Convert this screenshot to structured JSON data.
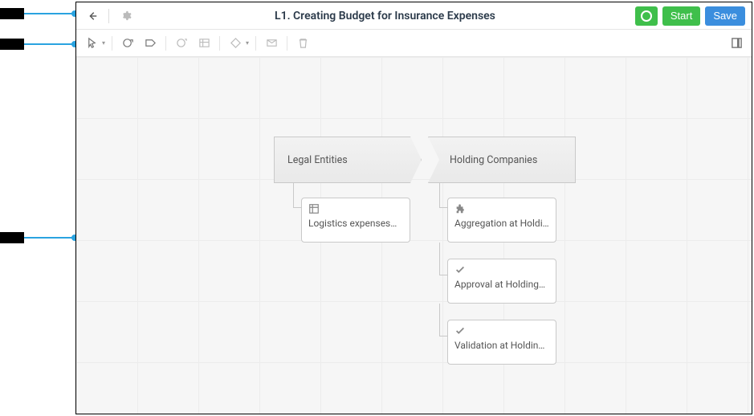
{
  "header": {
    "title": "L1. Creating Budget for Insurance Expenses",
    "start_label": "Start",
    "save_label": "Save"
  },
  "toolbar": {
    "tools": [
      "pointer",
      "create-stage",
      "create-task",
      "group",
      "table",
      "diamond",
      "layout",
      "delete"
    ]
  },
  "canvas": {
    "stages": [
      {
        "name": "Legal Entities"
      },
      {
        "name": "Holding Companies"
      }
    ],
    "nodes": [
      {
        "id": "n1",
        "label": "Logistics expenses…",
        "icon": "table"
      },
      {
        "id": "n2",
        "label": "Aggregation at Holding…",
        "icon": "puzzle"
      },
      {
        "id": "n3",
        "label": "Approval at Holding…",
        "icon": "check"
      },
      {
        "id": "n4",
        "label": "Validation at Holding…",
        "icon": "check"
      }
    ]
  }
}
